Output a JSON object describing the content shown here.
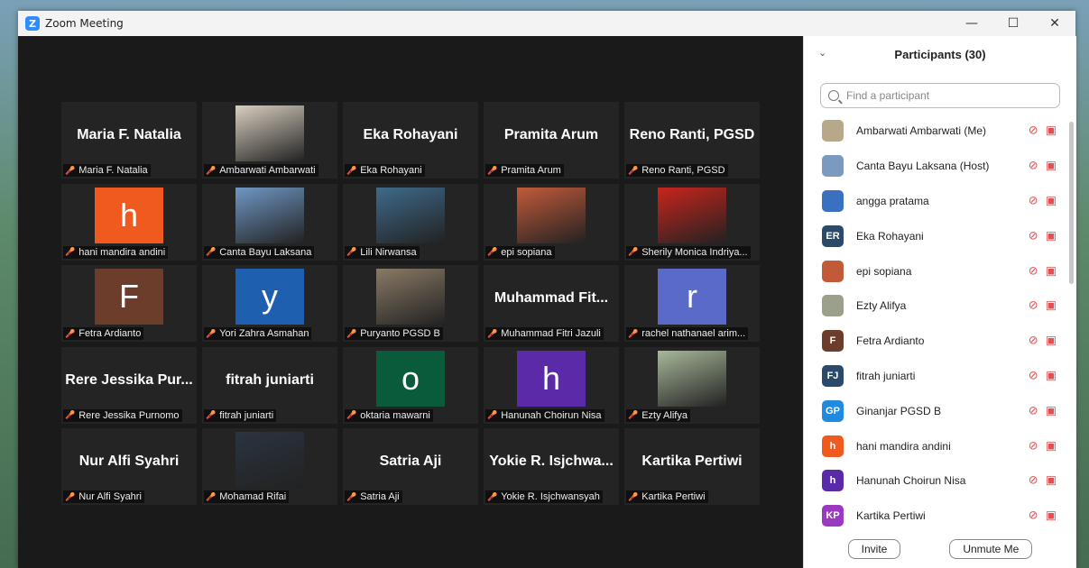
{
  "window": {
    "title": "Zoom Meeting",
    "min": "—",
    "max": "☐",
    "close": "✕"
  },
  "tiles": [
    {
      "name": "Maria F. Natalia",
      "label": "Maria F. Natalia",
      "kind": "name"
    },
    {
      "name": "",
      "label": "Ambarwati Ambarwati",
      "kind": "photo",
      "bg": "#d9cfc0"
    },
    {
      "name": "Eka Rohayani",
      "label": "Eka Rohayani",
      "kind": "name"
    },
    {
      "name": "Pramita Arum",
      "label": "Pramita Arum",
      "kind": "name"
    },
    {
      "name": "Reno Ranti, PGSD",
      "label": "Reno Ranti, PGSD",
      "kind": "name"
    },
    {
      "name": "h",
      "label": "hani mandira andini",
      "kind": "avatar",
      "bg": "#f05a1e"
    },
    {
      "name": "",
      "label": "Canta Bayu Laksana",
      "kind": "photo",
      "bg": "#6f97c4"
    },
    {
      "name": "",
      "label": "Lili Nirwansa",
      "kind": "photo",
      "bg": "#3e6a8a"
    },
    {
      "name": "",
      "label": "epi sopiana",
      "kind": "photo",
      "bg": "#c25a3a"
    },
    {
      "name": "",
      "label": "Sherily Monica Indriya...",
      "kind": "photo",
      "bg": "#c8241c"
    },
    {
      "name": "F",
      "label": "Fetra Ardianto",
      "kind": "avatar",
      "bg": "#6b3d2a"
    },
    {
      "name": "y",
      "label": "Yori Zahra Asmahan",
      "kind": "avatar",
      "bg": "#1f5fb0"
    },
    {
      "name": "",
      "label": "Puryanto PGSD B",
      "kind": "photo",
      "bg": "#8a7a66"
    },
    {
      "name": "Muhammad Fit...",
      "label": "Muhammad Fitri Jazuli",
      "kind": "name"
    },
    {
      "name": "r",
      "label": "rachel nathanael arim...",
      "kind": "avatar",
      "bg": "#5a6ac8"
    },
    {
      "name": "Rere Jessika Pur...",
      "label": "Rere Jessika Purnomo",
      "kind": "name"
    },
    {
      "name": "fitrah juniarti",
      "label": "fitrah juniarti",
      "kind": "name"
    },
    {
      "name": "o",
      "label": "oktaria mawarni",
      "kind": "avatar",
      "bg": "#0a5a3c"
    },
    {
      "name": "h",
      "label": "Hanunah Choirun Nisa",
      "kind": "avatar",
      "bg": "#5a2aa8"
    },
    {
      "name": "",
      "label": "Ezty Alifya",
      "kind": "photo",
      "bg": "#a8b89a"
    },
    {
      "name": "Nur Alfi Syahri",
      "label": "Nur Alfi Syahri",
      "kind": "name"
    },
    {
      "name": "",
      "label": "Mohamad Rifai",
      "kind": "photo",
      "bg": "#2a3440"
    },
    {
      "name": "Satria Aji",
      "label": "Satria Aji",
      "kind": "name"
    },
    {
      "name": "Yokie R. Isjchwa...",
      "label": "Yokie R. Isjchwansyah",
      "kind": "name"
    },
    {
      "name": "Kartika Pertiwi",
      "label": "Kartika Pertiwi",
      "kind": "name"
    }
  ],
  "panel": {
    "title": "Participants (30)",
    "search_placeholder": "Find a participant",
    "participants": [
      {
        "name": "Ambarwati Ambarwati (Me)",
        "initials": "",
        "color": "#b8a88a"
      },
      {
        "name": "Canta Bayu Laksana (Host)",
        "initials": "",
        "color": "#7a9ac0"
      },
      {
        "name": "angga pratama",
        "initials": "",
        "color": "#3a70c0"
      },
      {
        "name": "Eka Rohayani",
        "initials": "ER",
        "color": "#2a4a6a"
      },
      {
        "name": "epi sopiana",
        "initials": "",
        "color": "#c25a3a"
      },
      {
        "name": "Ezty Alifya",
        "initials": "",
        "color": "#9aa08a"
      },
      {
        "name": "Fetra Ardianto",
        "initials": "F",
        "color": "#6b3d2a"
      },
      {
        "name": "fitrah juniarti",
        "initials": "FJ",
        "color": "#2a4a6a"
      },
      {
        "name": "Ginanjar PGSD B",
        "initials": "GP",
        "color": "#1f8ae0"
      },
      {
        "name": "hani mandira andini",
        "initials": "h",
        "color": "#f05a1e"
      },
      {
        "name": "Hanunah Choirun Nisa",
        "initials": "h",
        "color": "#5a2aa8"
      },
      {
        "name": "Kartika Pertiwi",
        "initials": "KP",
        "color": "#9a3ac0"
      }
    ],
    "invite": "Invite",
    "unmute": "Unmute Me"
  }
}
